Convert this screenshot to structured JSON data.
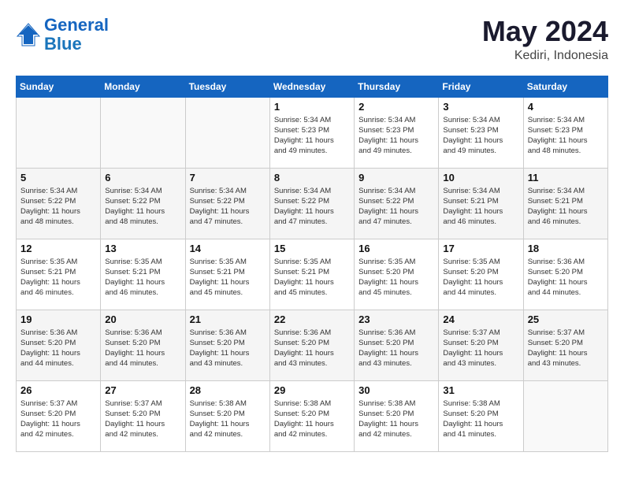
{
  "header": {
    "logo_line1": "General",
    "logo_line2": "Blue",
    "month": "May 2024",
    "location": "Kediri, Indonesia"
  },
  "days_of_week": [
    "Sunday",
    "Monday",
    "Tuesday",
    "Wednesday",
    "Thursday",
    "Friday",
    "Saturday"
  ],
  "weeks": [
    [
      {
        "day": "",
        "info": ""
      },
      {
        "day": "",
        "info": ""
      },
      {
        "day": "",
        "info": ""
      },
      {
        "day": "1",
        "info": "Sunrise: 5:34 AM\nSunset: 5:23 PM\nDaylight: 11 hours\nand 49 minutes."
      },
      {
        "day": "2",
        "info": "Sunrise: 5:34 AM\nSunset: 5:23 PM\nDaylight: 11 hours\nand 49 minutes."
      },
      {
        "day": "3",
        "info": "Sunrise: 5:34 AM\nSunset: 5:23 PM\nDaylight: 11 hours\nand 49 minutes."
      },
      {
        "day": "4",
        "info": "Sunrise: 5:34 AM\nSunset: 5:23 PM\nDaylight: 11 hours\nand 48 minutes."
      }
    ],
    [
      {
        "day": "5",
        "info": "Sunrise: 5:34 AM\nSunset: 5:22 PM\nDaylight: 11 hours\nand 48 minutes."
      },
      {
        "day": "6",
        "info": "Sunrise: 5:34 AM\nSunset: 5:22 PM\nDaylight: 11 hours\nand 48 minutes."
      },
      {
        "day": "7",
        "info": "Sunrise: 5:34 AM\nSunset: 5:22 PM\nDaylight: 11 hours\nand 47 minutes."
      },
      {
        "day": "8",
        "info": "Sunrise: 5:34 AM\nSunset: 5:22 PM\nDaylight: 11 hours\nand 47 minutes."
      },
      {
        "day": "9",
        "info": "Sunrise: 5:34 AM\nSunset: 5:22 PM\nDaylight: 11 hours\nand 47 minutes."
      },
      {
        "day": "10",
        "info": "Sunrise: 5:34 AM\nSunset: 5:21 PM\nDaylight: 11 hours\nand 46 minutes."
      },
      {
        "day": "11",
        "info": "Sunrise: 5:34 AM\nSunset: 5:21 PM\nDaylight: 11 hours\nand 46 minutes."
      }
    ],
    [
      {
        "day": "12",
        "info": "Sunrise: 5:35 AM\nSunset: 5:21 PM\nDaylight: 11 hours\nand 46 minutes."
      },
      {
        "day": "13",
        "info": "Sunrise: 5:35 AM\nSunset: 5:21 PM\nDaylight: 11 hours\nand 46 minutes."
      },
      {
        "day": "14",
        "info": "Sunrise: 5:35 AM\nSunset: 5:21 PM\nDaylight: 11 hours\nand 45 minutes."
      },
      {
        "day": "15",
        "info": "Sunrise: 5:35 AM\nSunset: 5:21 PM\nDaylight: 11 hours\nand 45 minutes."
      },
      {
        "day": "16",
        "info": "Sunrise: 5:35 AM\nSunset: 5:20 PM\nDaylight: 11 hours\nand 45 minutes."
      },
      {
        "day": "17",
        "info": "Sunrise: 5:35 AM\nSunset: 5:20 PM\nDaylight: 11 hours\nand 44 minutes."
      },
      {
        "day": "18",
        "info": "Sunrise: 5:36 AM\nSunset: 5:20 PM\nDaylight: 11 hours\nand 44 minutes."
      }
    ],
    [
      {
        "day": "19",
        "info": "Sunrise: 5:36 AM\nSunset: 5:20 PM\nDaylight: 11 hours\nand 44 minutes."
      },
      {
        "day": "20",
        "info": "Sunrise: 5:36 AM\nSunset: 5:20 PM\nDaylight: 11 hours\nand 44 minutes."
      },
      {
        "day": "21",
        "info": "Sunrise: 5:36 AM\nSunset: 5:20 PM\nDaylight: 11 hours\nand 43 minutes."
      },
      {
        "day": "22",
        "info": "Sunrise: 5:36 AM\nSunset: 5:20 PM\nDaylight: 11 hours\nand 43 minutes."
      },
      {
        "day": "23",
        "info": "Sunrise: 5:36 AM\nSunset: 5:20 PM\nDaylight: 11 hours\nand 43 minutes."
      },
      {
        "day": "24",
        "info": "Sunrise: 5:37 AM\nSunset: 5:20 PM\nDaylight: 11 hours\nand 43 minutes."
      },
      {
        "day": "25",
        "info": "Sunrise: 5:37 AM\nSunset: 5:20 PM\nDaylight: 11 hours\nand 43 minutes."
      }
    ],
    [
      {
        "day": "26",
        "info": "Sunrise: 5:37 AM\nSunset: 5:20 PM\nDaylight: 11 hours\nand 42 minutes."
      },
      {
        "day": "27",
        "info": "Sunrise: 5:37 AM\nSunset: 5:20 PM\nDaylight: 11 hours\nand 42 minutes."
      },
      {
        "day": "28",
        "info": "Sunrise: 5:38 AM\nSunset: 5:20 PM\nDaylight: 11 hours\nand 42 minutes."
      },
      {
        "day": "29",
        "info": "Sunrise: 5:38 AM\nSunset: 5:20 PM\nDaylight: 11 hours\nand 42 minutes."
      },
      {
        "day": "30",
        "info": "Sunrise: 5:38 AM\nSunset: 5:20 PM\nDaylight: 11 hours\nand 42 minutes."
      },
      {
        "day": "31",
        "info": "Sunrise: 5:38 AM\nSunset: 5:20 PM\nDaylight: 11 hours\nand 41 minutes."
      },
      {
        "day": "",
        "info": ""
      }
    ]
  ]
}
